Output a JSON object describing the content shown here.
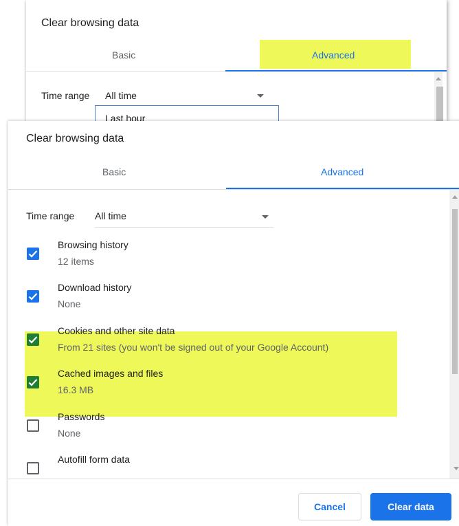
{
  "back_dialog": {
    "title": "Clear browsing data",
    "tabs": [
      {
        "label": "Basic"
      },
      {
        "label": "Advanced"
      }
    ],
    "time_range_label": "Time range",
    "time_range_value": "All time",
    "dropdown_first_option": "Last hour"
  },
  "dialog": {
    "title": "Clear browsing data",
    "tabs": [
      {
        "label": "Basic",
        "selected": false
      },
      {
        "label": "Advanced",
        "selected": true
      }
    ],
    "time_range": {
      "label": "Time range",
      "value": "All time"
    },
    "options": [
      {
        "label": "Browsing history",
        "detail": "12 items",
        "checked": true
      },
      {
        "label": "Download history",
        "detail": "None",
        "checked": true
      },
      {
        "label": "Cookies and other site data",
        "detail": "From 21 sites (you won't be signed out of your Google Account)",
        "checked": true,
        "highlighted": true
      },
      {
        "label": "Cached images and files",
        "detail": "16.3 MB",
        "checked": true,
        "highlighted": true
      },
      {
        "label": "Passwords",
        "detail": "None",
        "checked": false
      },
      {
        "label": "Autofill form data",
        "detail": "",
        "checked": false
      }
    ],
    "buttons": {
      "cancel": "Cancel",
      "clear": "Clear data"
    }
  },
  "colors": {
    "accent": "#1a73e8",
    "highlight": "#eef859",
    "checked_green": "#1e7e34"
  }
}
